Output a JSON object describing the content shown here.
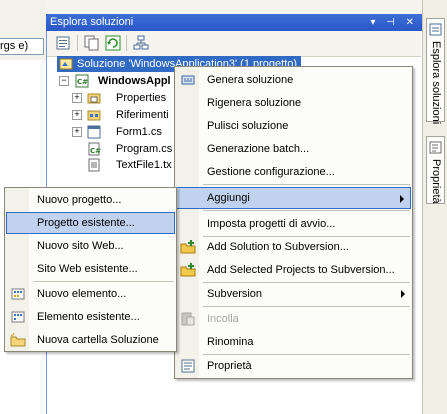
{
  "editor": {
    "combo_text": "rgs e)"
  },
  "panel": {
    "title": "Esplora soluzioni",
    "controls": "▾ ⊣ ✕"
  },
  "tree": {
    "solution_label": "Soluzione 'WindowsApplication3' (1 progetto)",
    "project_label": "WindowsAppl",
    "items": [
      {
        "label": "Properties",
        "icon": "properties-folder-icon"
      },
      {
        "label": "Riferimenti",
        "icon": "references-folder-icon"
      },
      {
        "label": "Form1.cs",
        "icon": "form-file-icon"
      },
      {
        "label": "Program.cs",
        "icon": "csharp-file-icon"
      },
      {
        "label": "TextFile1.tx",
        "icon": "text-file-icon"
      }
    ]
  },
  "right_tabs": {
    "tab1": "Esplora soluzioni",
    "tab2": "Proprietà"
  },
  "context_menu": {
    "items": [
      {
        "label": "Genera soluzione"
      },
      {
        "label": "Rigenera soluzione"
      },
      {
        "label": "Pulisci soluzione"
      },
      {
        "label": "Generazione batch..."
      },
      {
        "label": "Gestione configurazione..."
      },
      {
        "label": "Aggiungi"
      },
      {
        "label": "Imposta progetti di avvio..."
      },
      {
        "label": "Add Solution to Subversion..."
      },
      {
        "label": "Add Selected Projects to Subversion..."
      },
      {
        "label": "Subversion"
      },
      {
        "label": "Incolla"
      },
      {
        "label": "Rinomina"
      },
      {
        "label": "Proprietà"
      }
    ]
  },
  "submenu": {
    "items": [
      {
        "label": "Nuovo progetto..."
      },
      {
        "label": "Progetto esistente..."
      },
      {
        "label": "Nuovo sito Web..."
      },
      {
        "label": "Sito Web esistente..."
      },
      {
        "label": "Nuovo elemento..."
      },
      {
        "label": "Elemento esistente..."
      },
      {
        "label": "Nuova cartella Soluzione"
      }
    ]
  },
  "colors": {
    "title_bar": "#2a58c8",
    "selection": "#316ac5",
    "menu_highlight": "#c1d2ee"
  }
}
